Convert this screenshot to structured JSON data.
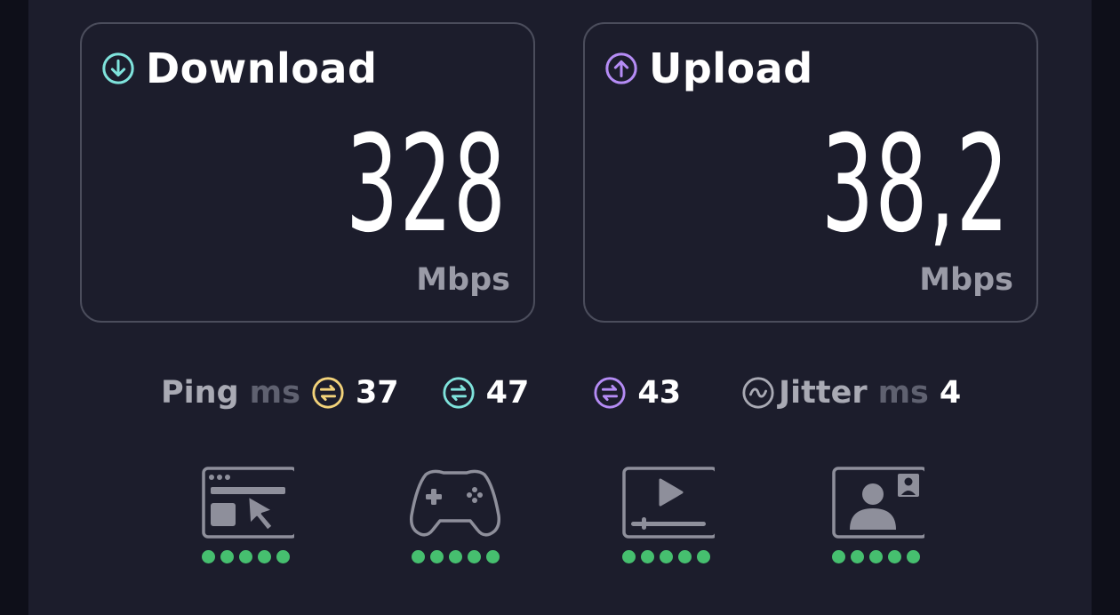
{
  "download": {
    "title": "Download",
    "value": "328",
    "unit": "Mbps",
    "icon": "arrow-down-circle-icon",
    "accent": "#7fe3dc"
  },
  "upload": {
    "title": "Upload",
    "value": "38,2",
    "unit": "Mbps",
    "icon": "arrow-up-circle-icon",
    "accent": "#b58cf5"
  },
  "ping": {
    "label": "Ping",
    "unit": "ms",
    "idle": {
      "value": "37",
      "color": "#f3d37a"
    },
    "download": {
      "value": "47",
      "color": "#7fe3dc"
    },
    "upload": {
      "value": "43",
      "color": "#b58cf5"
    }
  },
  "jitter": {
    "label": "Jitter",
    "unit": "ms",
    "value": "4",
    "icon": "wave-circle-icon"
  },
  "apps": [
    {
      "icon": "web-browsing-icon",
      "rating": 5
    },
    {
      "icon": "gaming-controller-icon",
      "rating": 5
    },
    {
      "icon": "video-streaming-icon",
      "rating": 5
    },
    {
      "icon": "video-call-icon",
      "rating": 5
    }
  ]
}
